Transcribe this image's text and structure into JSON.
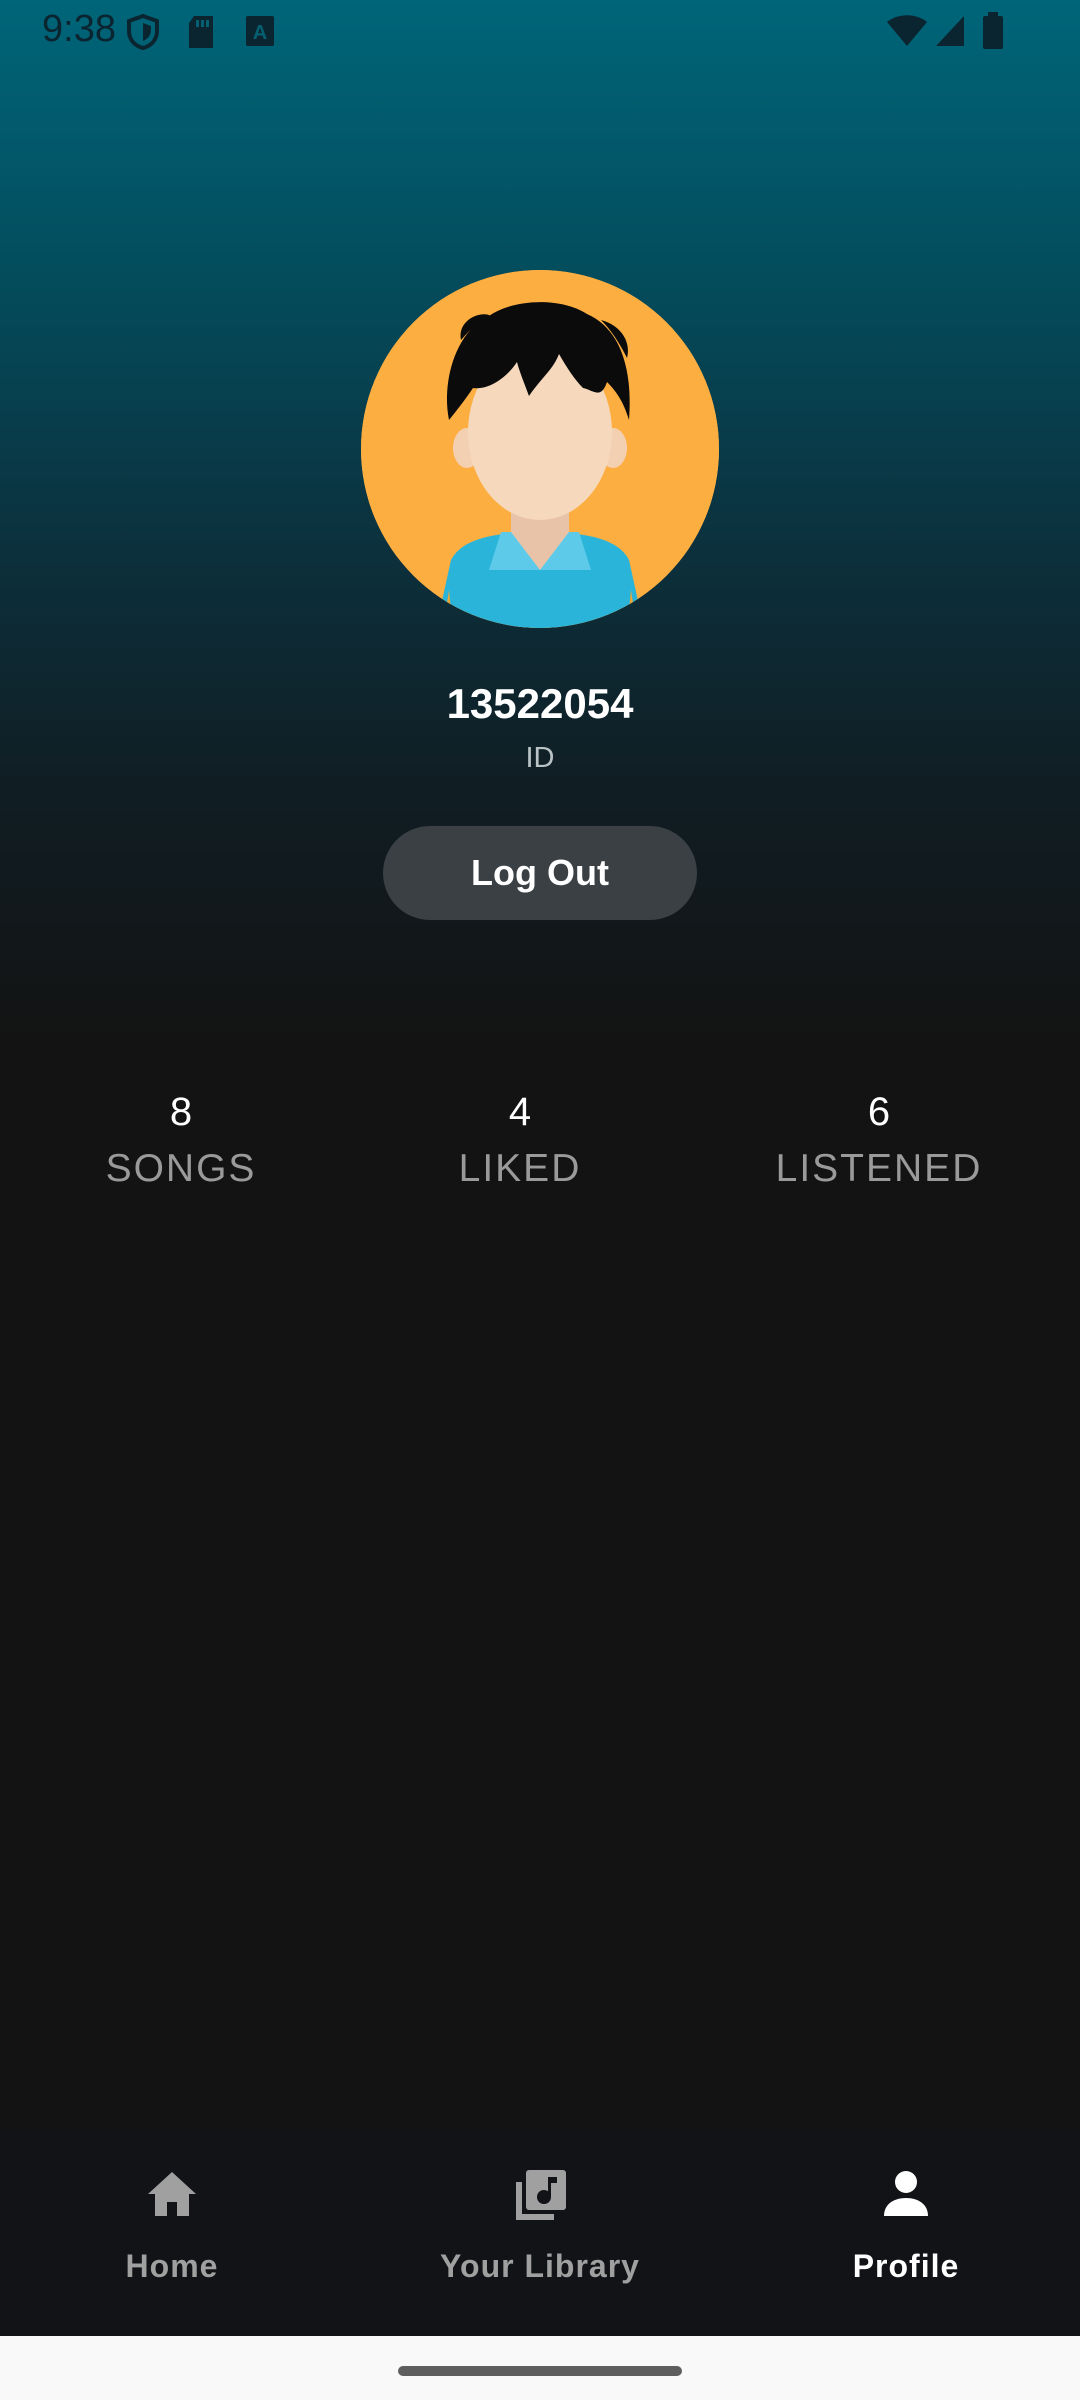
{
  "status_bar": {
    "time": "9:38",
    "icons_left": [
      "shield-icon",
      "sd-card-icon",
      "keyboard-a-icon"
    ],
    "icons_right": [
      "wifi-icon",
      "signal-icon",
      "battery-icon"
    ]
  },
  "profile": {
    "avatar": "avatar",
    "user_id": "13522054",
    "id_label": "ID",
    "logout_label": "Log Out"
  },
  "stats": [
    {
      "value": "8",
      "label": "SONGS"
    },
    {
      "value": "4",
      "label": "LIKED"
    },
    {
      "value": "6",
      "label": "LISTENED"
    }
  ],
  "nav": {
    "items": [
      {
        "label": "Home",
        "icon": "home-icon",
        "active": false
      },
      {
        "label": "Your Library",
        "icon": "library-music-icon",
        "active": false
      },
      {
        "label": "Profile",
        "icon": "person-icon",
        "active": true
      }
    ]
  },
  "colors": {
    "gradient_top": "#006579",
    "background": "#131313",
    "avatar_bg": "#fcae41",
    "button_bg": "#3a4043",
    "nav_active": "#ffffff",
    "nav_inactive": "#a0a0a0"
  }
}
